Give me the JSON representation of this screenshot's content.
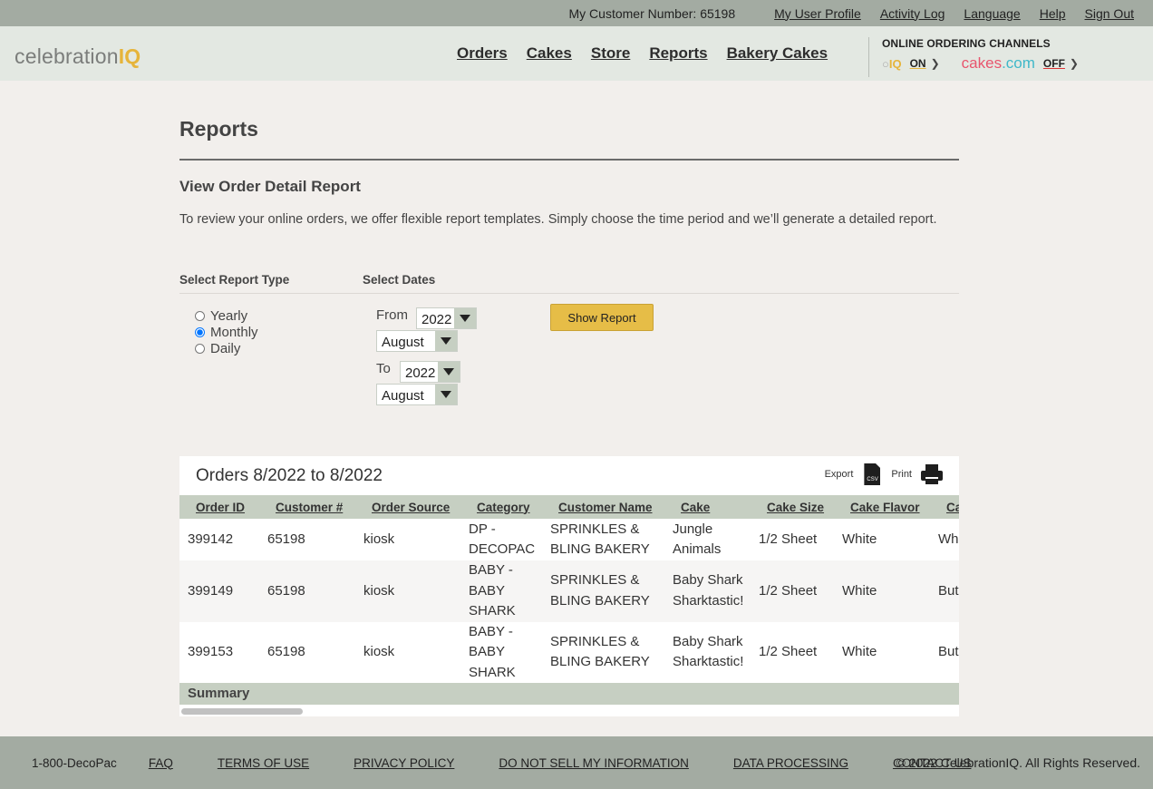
{
  "topbar": {
    "customer_number": "My Customer Number: 65198",
    "links": [
      "My User Profile",
      "Activity Log",
      "Language",
      "Help",
      "Sign Out"
    ]
  },
  "header": {
    "logo_text": "celebration",
    "logo_accent": "IQ",
    "nav": [
      "Orders",
      "Cakes",
      "Store",
      "Reports",
      "Bakery Cakes"
    ],
    "channels_title": "ONLINE ORDERING CHANNELS",
    "ciq_logo": "IQ",
    "ciq_status": "ON",
    "cakescom_logo_main": "cakes",
    "cakescom_logo_suffix": ".com",
    "cakescom_status": "OFF"
  },
  "main": {
    "page_title": "Reports",
    "sub_title": "View Order Detail Report",
    "intro": "To review your online orders, we offer flexible report templates. Simply choose the time period and we’ll generate a detailed report.",
    "report_type_label": "Select Report Type",
    "dates_label": "Select Dates",
    "report_types": [
      "Yearly",
      "Monthly",
      "Daily"
    ],
    "selected_report_type": "Monthly",
    "from_label": "From",
    "to_label": "To",
    "from_year": "2022",
    "from_month": "August",
    "to_year": "2022",
    "to_month": "August",
    "show_button": "Show Report"
  },
  "report": {
    "title": "Orders 8/2022 to 8/2022",
    "export_label": "Export",
    "csv_label": "CSV",
    "print_label": "Print",
    "columns": [
      "Order ID",
      "Customer #",
      "Order Source",
      "Category",
      "Customer Name",
      "Cake",
      "Cake Size",
      "Cake Flavor",
      "Ca"
    ],
    "rows": [
      [
        "399142",
        "65198",
        "kiosk",
        "DP - DECOPAC",
        "SPRINKLES & BLING BAKERY",
        "Jungle Animals",
        "1/2 Sheet",
        "White",
        "Wh - Ch"
      ],
      [
        "399149",
        "65198",
        "kiosk",
        "BABY - BABY SHARK",
        "SPRINKLES & BLING BAKERY",
        "Baby Shark Sharktastic!",
        "1/2 Sheet",
        "White",
        "But Wh"
      ],
      [
        "399153",
        "65198",
        "kiosk",
        "BABY - BABY SHARK",
        "SPRINKLES & BLING BAKERY",
        "Baby Shark Sharktastic!",
        "1/2 Sheet",
        "White",
        "But Wh"
      ]
    ],
    "summary_label": "Summary"
  },
  "footer": {
    "phone": "1-800-DecoPac",
    "links": [
      "FAQ",
      "TERMS OF USE",
      "PRIVACY POLICY",
      "DO NOT SELL MY INFORMATION",
      "DATA PROCESSING",
      "CONTACT US"
    ],
    "copyright": "© 2022 CelebrationIQ. All Rights Reserved."
  }
}
